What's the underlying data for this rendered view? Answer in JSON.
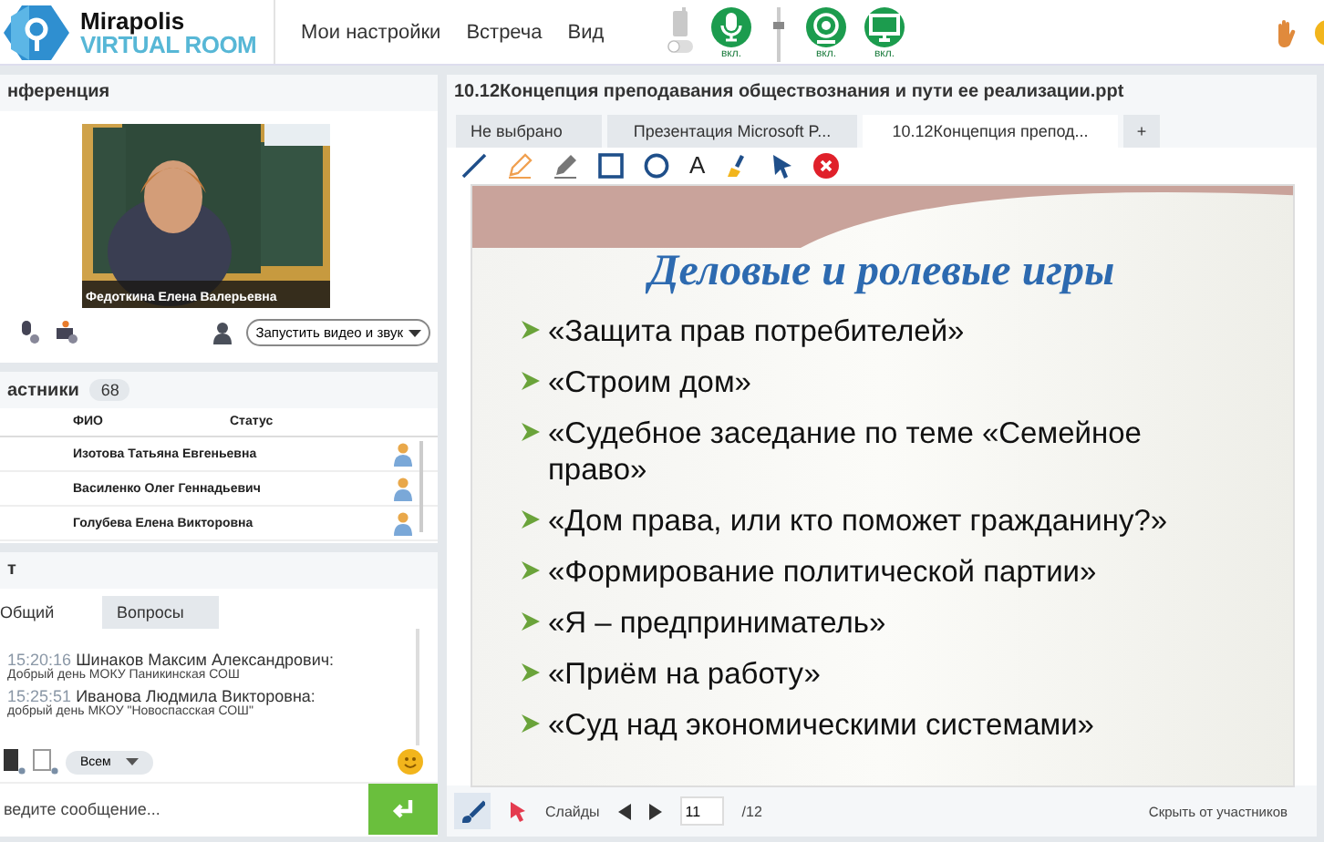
{
  "header": {
    "logo": {
      "line1": "Mirapolis",
      "line2": "VIRTUAL ROOM"
    },
    "menu": [
      "Мои настройки",
      "Встреча",
      "Вид"
    ],
    "phone_toggle": {
      "on": false
    },
    "devices": [
      {
        "kind": "mic",
        "label": "вкл.",
        "on": true
      },
      {
        "kind": "camera",
        "label": "вкл.",
        "on": true
      },
      {
        "kind": "screen",
        "label": "вкл.",
        "on": true
      }
    ]
  },
  "conference": {
    "title": "нференция",
    "caption": "Федоткина  Елена  Валерьевна",
    "start_button": "Запустить видео и звук"
  },
  "participants": {
    "title": "астники",
    "count": "68",
    "columns": [
      "ФИО",
      "Статус"
    ],
    "rows": [
      {
        "name": "Изотова Татьяна  Евгеньевна"
      },
      {
        "name": "Василенко Олег  Геннадьевич"
      },
      {
        "name": "Голубева Елена  Викторовна"
      }
    ]
  },
  "chat": {
    "title": "т",
    "tabs": [
      {
        "label": "Общий",
        "selected": true
      },
      {
        "label": "Вопросы",
        "selected": false
      }
    ],
    "messages": [
      {
        "time": "15:20:16",
        "author": "Шинаков Максим  Александрович:",
        "text": "Добрый день МОКУ Паникинская СОШ"
      },
      {
        "time": "15:25:51",
        "author": "Иванова Людмила  Викторовна:",
        "text": "добрый день МКОУ \"Новоспасская СОШ\""
      }
    ],
    "recipient": "Всем",
    "input": {
      "placeholder": "ведите сообщение..."
    }
  },
  "document": {
    "title": "10.12Концепция преподавания обществознания и пути ее реализации.ppt",
    "tabs": [
      {
        "label": "Не выбрано",
        "selected": false
      },
      {
        "label": "Презентация Microsoft P...",
        "selected": false
      },
      {
        "label": "10.12Концепция препод...",
        "selected": true
      }
    ],
    "add_tab": "+",
    "tools": [
      {
        "kind": "line"
      },
      {
        "kind": "pencil"
      },
      {
        "kind": "marker"
      },
      {
        "kind": "rect"
      },
      {
        "kind": "circle"
      },
      {
        "kind": "text",
        "glyph": "A"
      },
      {
        "kind": "brush"
      },
      {
        "kind": "pointer"
      },
      {
        "kind": "clear"
      }
    ],
    "slide": {
      "title": "Деловые и ролевые игры",
      "bullets": [
        "«Защита прав потребителей»",
        "«Строим дом»",
        "«Судебное заседание по теме «Семейное право»",
        "«Дом права, или кто поможет гражданину?»",
        "«Формирование политической партии»",
        "«Я – предприниматель»",
        "«Приём на работу»",
        "«Суд над экономическими системами»"
      ]
    },
    "footer": {
      "slides_label": "Слайды",
      "page": "11",
      "total": "/12",
      "hide_button": "Скрыть от участников"
    }
  }
}
